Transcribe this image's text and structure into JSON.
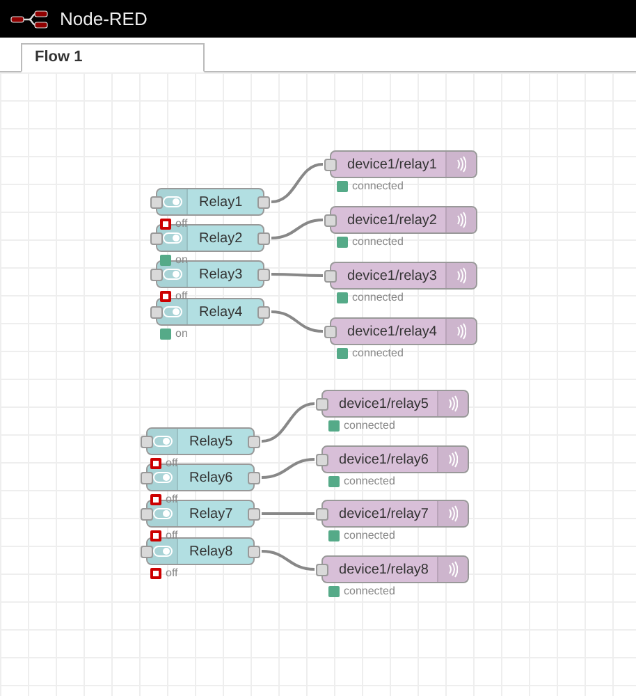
{
  "header": {
    "title": "Node-RED"
  },
  "tabs": [
    {
      "label": "Flow 1",
      "selected": true
    }
  ],
  "flows": [
    {
      "switch": {
        "label": "Relay1",
        "on": false,
        "status": "off"
      },
      "device": {
        "label": "device1/relay1",
        "connected": true,
        "status": "connected"
      }
    },
    {
      "switch": {
        "label": "Relay2",
        "on": true,
        "status": "on"
      },
      "device": {
        "label": "device1/relay2",
        "connected": true,
        "status": "connected"
      }
    },
    {
      "switch": {
        "label": "Relay3",
        "on": false,
        "status": "off"
      },
      "device": {
        "label": "device1/relay3",
        "connected": true,
        "status": "connected"
      }
    },
    {
      "switch": {
        "label": "Relay4",
        "on": true,
        "status": "on"
      },
      "device": {
        "label": "device1/relay4",
        "connected": true,
        "status": "connected"
      }
    },
    {
      "switch": {
        "label": "Relay5",
        "on": false,
        "status": "off"
      },
      "device": {
        "label": "device1/relay5",
        "connected": true,
        "status": "connected"
      }
    },
    {
      "switch": {
        "label": "Relay6",
        "on": false,
        "status": "off"
      },
      "device": {
        "label": "device1/relay6",
        "connected": true,
        "status": "connected"
      }
    },
    {
      "switch": {
        "label": "Relay7",
        "on": false,
        "status": "off"
      },
      "device": {
        "label": "device1/relay7",
        "connected": true,
        "status": "connected"
      }
    },
    {
      "switch": {
        "label": "Relay8",
        "on": false,
        "status": "off"
      },
      "device": {
        "label": "device1/relay8",
        "connected": true,
        "status": "connected"
      }
    }
  ]
}
